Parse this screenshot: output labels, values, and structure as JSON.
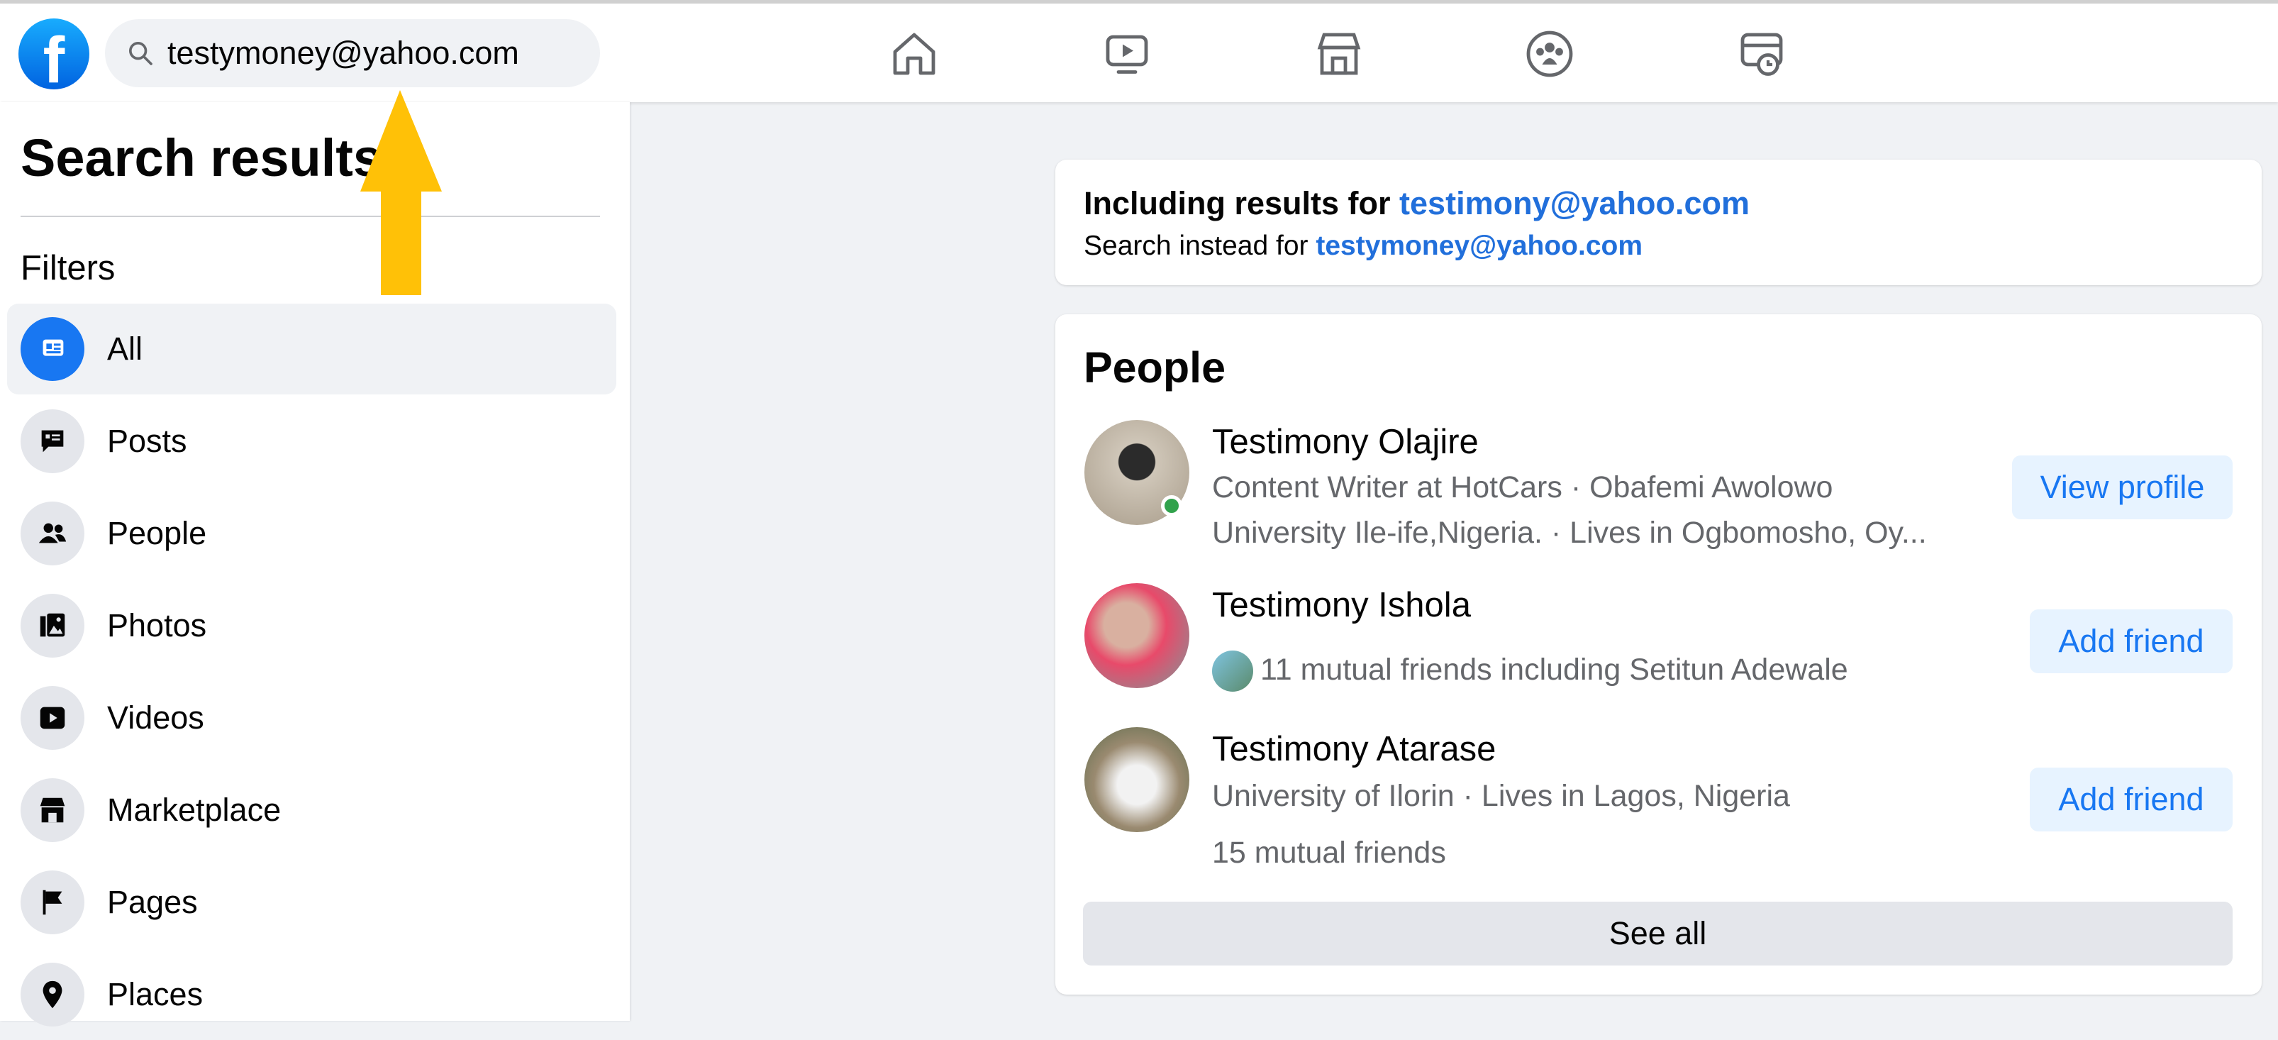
{
  "search": {
    "value": "testymoney@yahoo.com"
  },
  "nav": [
    "home-icon",
    "watch-icon",
    "marketplace-icon",
    "groups-icon",
    "gaming-icon"
  ],
  "sidebar": {
    "title": "Search results",
    "filters_label": "Filters",
    "items": [
      {
        "label": "All",
        "icon": "all-results-icon",
        "active": true
      },
      {
        "label": "Posts",
        "icon": "posts-icon"
      },
      {
        "label": "People",
        "icon": "people-icon"
      },
      {
        "label": "Photos",
        "icon": "photos-icon"
      },
      {
        "label": "Videos",
        "icon": "videos-icon"
      },
      {
        "label": "Marketplace",
        "icon": "marketplace-icon"
      },
      {
        "label": "Pages",
        "icon": "flag-icon"
      },
      {
        "label": "Places",
        "icon": "location-pin-icon"
      }
    ]
  },
  "correction": {
    "including_prefix": "Including results for ",
    "including_query": "testimony@yahoo.com",
    "instead_prefix": "Search instead for ",
    "instead_query": "testymoney@yahoo.com"
  },
  "people": {
    "title": "People",
    "results": [
      {
        "name": "Testimony Olajire",
        "line1": "Content Writer at HotCars · Obafemi Awolowo",
        "line2": "University Ile-ife,Nigeria. · Lives in Ogbomosho, Oy...",
        "button": "View profile",
        "online": true
      },
      {
        "name": "Testimony Ishola",
        "line1": "11 mutual friends including Setitun Adewale",
        "button": "Add friend"
      },
      {
        "name": "Testimony Atarase",
        "line1": "University of Ilorin · Lives in Lagos, Nigeria",
        "line2": "15 mutual friends",
        "button": "Add friend"
      }
    ],
    "see_all": "See all"
  },
  "colors": {
    "accent": "#1877f2",
    "link": "#216fdb",
    "annotation_arrow": "#ffc107",
    "online": "#31a24c"
  }
}
